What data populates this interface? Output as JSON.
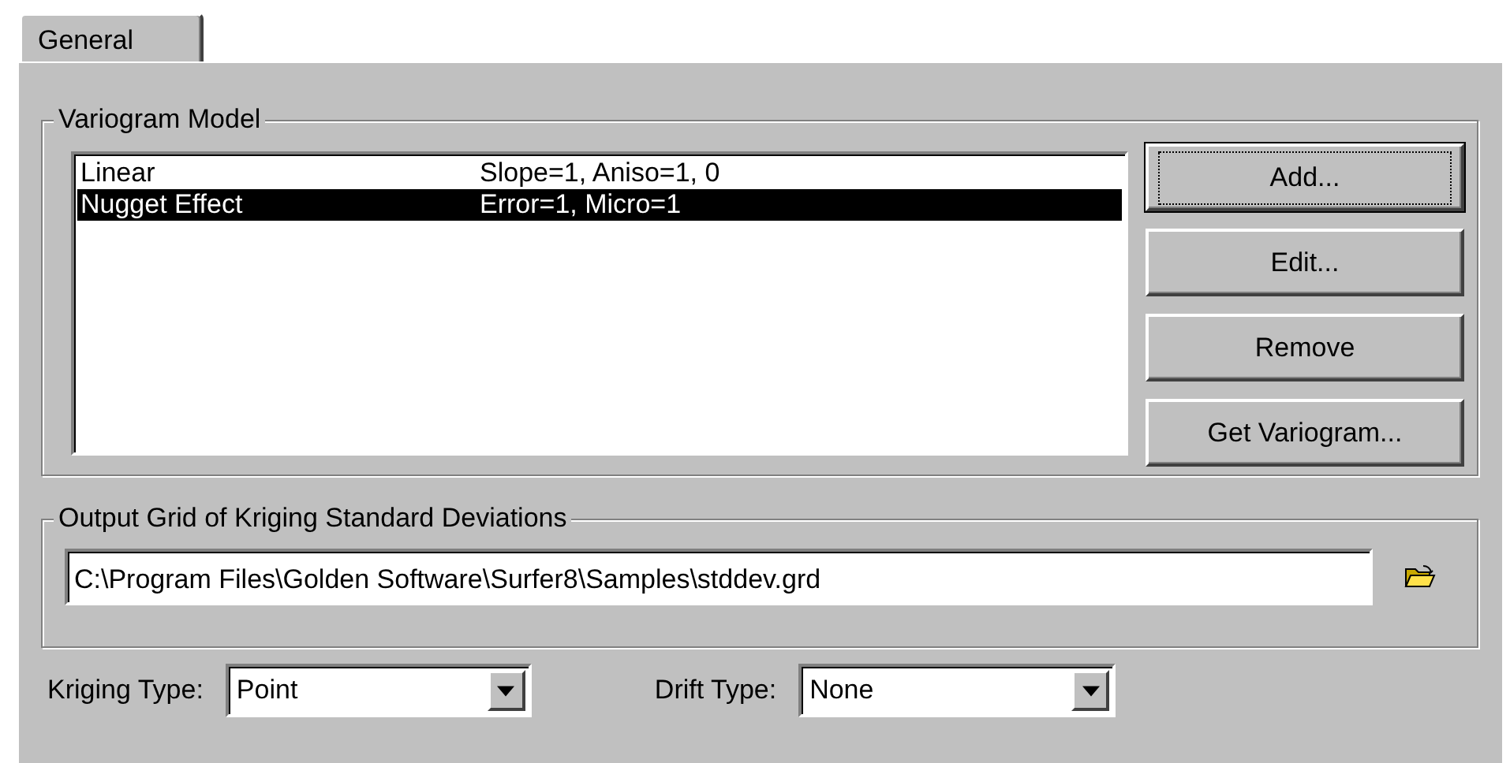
{
  "tabs": [
    {
      "label": "General",
      "selected": true
    }
  ],
  "variogram_model": {
    "title": "Variogram Model",
    "items": [
      {
        "name": "Linear",
        "parameters": "Slope=1, Aniso=1, 0",
        "selected": false
      },
      {
        "name": "Nugget Effect",
        "parameters": "Error=1, Micro=1",
        "selected": true
      }
    ],
    "buttons": [
      {
        "label": "Add...",
        "focused": true
      },
      {
        "label": "Edit...",
        "focused": false
      },
      {
        "label": "Remove",
        "focused": false
      },
      {
        "label": "Get Variogram...",
        "focused": false
      }
    ]
  },
  "output_grid": {
    "title": "Output Grid of Kriging Standard Deviations",
    "value": "C:\\Program Files\\Golden Software\\Surfer8\\Samples\\stddev.grd"
  },
  "options": [
    {
      "label": "Kriging Type:",
      "value": "Point"
    },
    {
      "label": "Drift Type:",
      "value": "None"
    }
  ]
}
